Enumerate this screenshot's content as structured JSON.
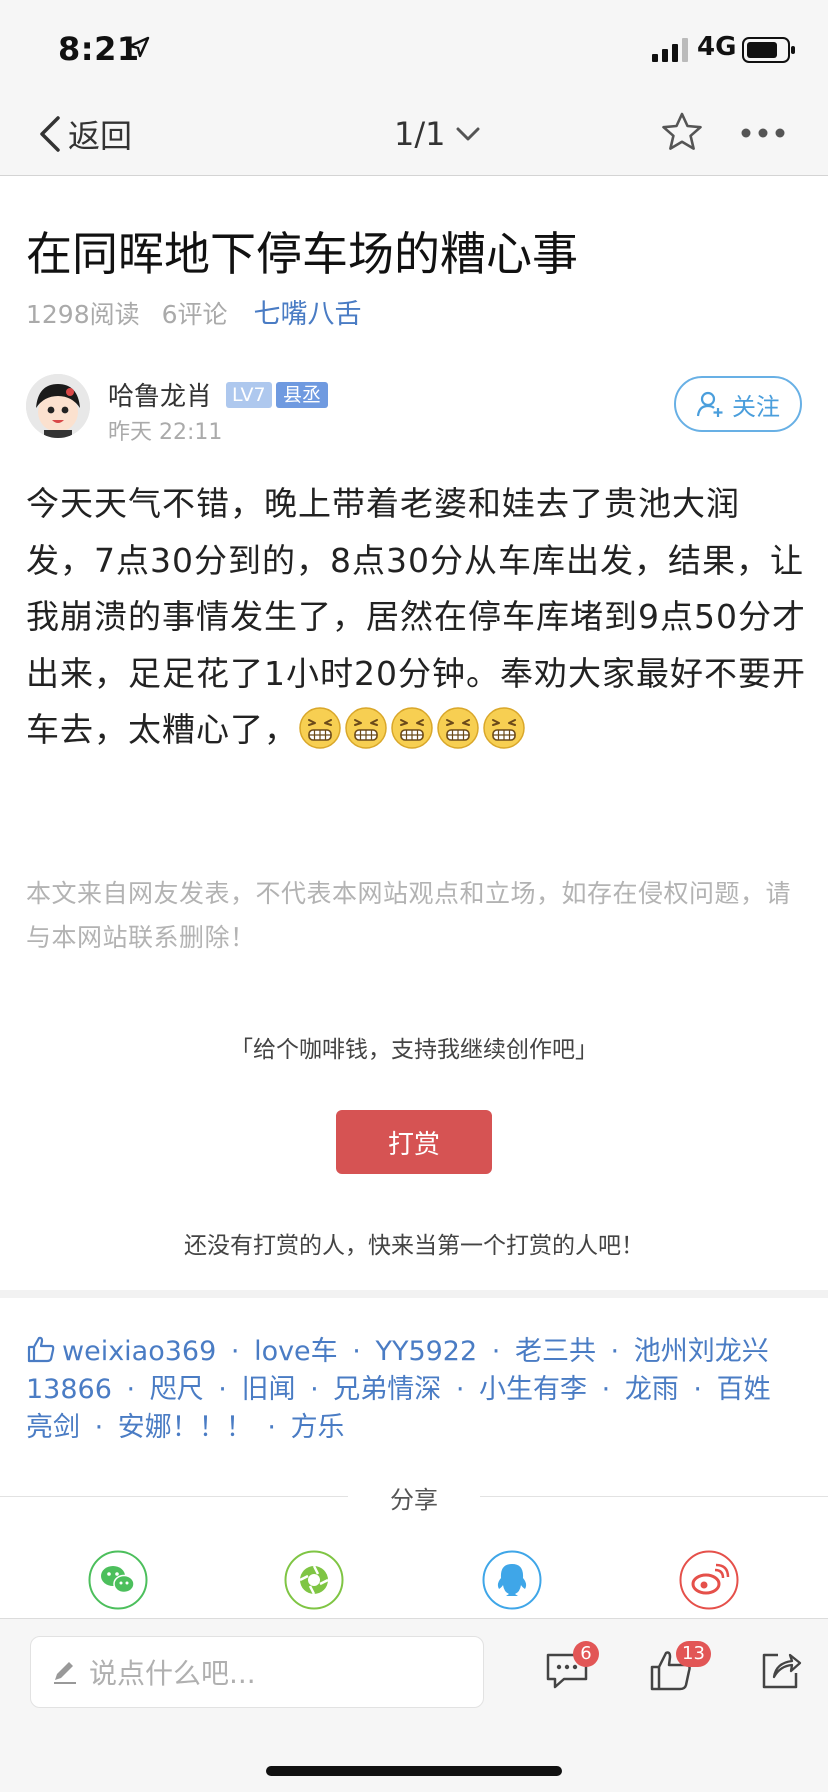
{
  "status_bar": {
    "time": "8:21",
    "network": "4G"
  },
  "nav": {
    "back_label": "返回",
    "pager_label": "1/1"
  },
  "article": {
    "title": "在同晖地下停车场的糟心事",
    "reads": "1298阅读",
    "comments": "6评论",
    "category": "七嘴八舌"
  },
  "author": {
    "name": "哈鲁龙肖",
    "level": "LV7",
    "role": "县丞",
    "time": "昨天 22:11",
    "follow_label": "关注"
  },
  "content": {
    "text": "今天天气不错，晚上带着老婆和娃去了贵池大润发，7点30分到的，8点30分从车库出发，结果，让我崩溃的事情发生了，居然在停车库堵到9点50分才出来，足足花了1小时20分钟。奉劝大家最好不要开车去，太糟心了，",
    "emoji_icon": "grimacing-face-icon",
    "emoji_count": 5
  },
  "disclaimer": "本文来自网友发表，不代表本网站观点和立场，如存在侵权问题，请与本网站联系删除！",
  "reward": {
    "quote": "「给个咖啡钱，支持我继续创作吧」",
    "button_label": "打赏",
    "empty_text": "还没有打赏的人，快来当第一个打赏的人吧！"
  },
  "likes": {
    "separator": "·",
    "users": [
      "weixiao369",
      "love车",
      "YY5922",
      "老三共",
      "池州刘龙兴13866",
      "咫尺",
      "旧闻",
      "兄弟情深",
      "小生有李",
      "龙雨",
      "百姓亮剑",
      "安娜！！！",
      "方乐"
    ]
  },
  "share": {
    "title": "分享",
    "targets": [
      {
        "icon": "wechat-icon",
        "color": "#4cbf5c"
      },
      {
        "icon": "moments-icon",
        "color": "#7fc544"
      },
      {
        "icon": "qq-icon",
        "color": "#3fa6e8"
      },
      {
        "icon": "weibo-icon",
        "color": "#e5504a"
      }
    ]
  },
  "bottom_bar": {
    "comment_placeholder": "说点什么吧...",
    "comment_count": "6",
    "like_count": "13"
  },
  "colors": {
    "link_blue": "#4a7cc4",
    "follow_blue": "#4a9edc",
    "reward_red": "#d65353",
    "badge_red": "#e25656"
  }
}
